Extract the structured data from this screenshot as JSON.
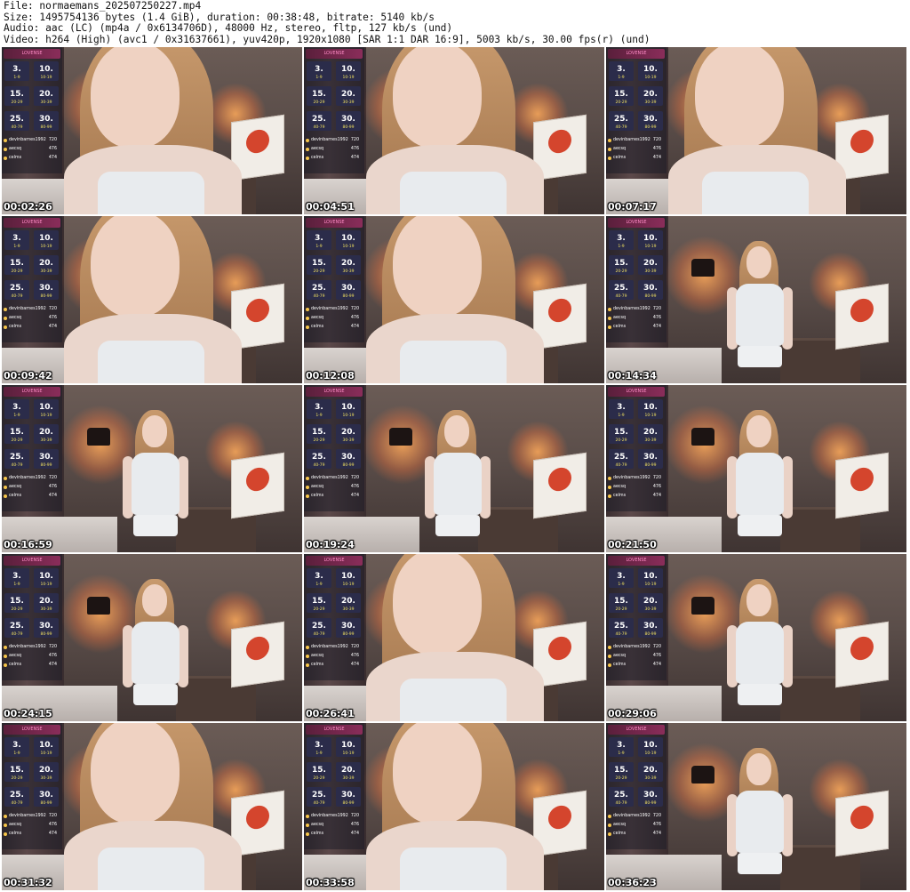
{
  "meta": {
    "file_line": "File: normaemans_202507250227.mp4",
    "size_line": "Size: 1495754136 bytes (1.4 GiB), duration: 00:38:48, bitrate: 5140 kb/s",
    "audio_line": "Audio: aac (LC) (mp4a / 0x6134706D), 48000 Hz, stereo, fltp, 127 kb/s (und)",
    "video_line": "Video: h264 (High) (avc1 / 0x31637661), yuv420p, 1920x1080 [SAR 1:1 DAR 16:9], 5003 kb/s, 30.00 fps(r) (und)"
  },
  "overlay": {
    "header": "LOVENSE",
    "tiles": [
      {
        "value": "3.",
        "range": "1-9"
      },
      {
        "value": "10.",
        "range": "10-19"
      },
      {
        "value": "15.",
        "range": "20-29"
      },
      {
        "value": "20.",
        "range": "30-39"
      },
      {
        "value": "25.",
        "range": "40-79"
      },
      {
        "value": "30.",
        "range": "80-99"
      }
    ],
    "tippers": [
      {
        "name": "devinbarnes1992",
        "amount": "720"
      },
      {
        "name": "aecsq",
        "amount": "476"
      },
      {
        "name": "celms",
        "amount": "474"
      }
    ]
  },
  "thumbnails": [
    {
      "timestamp": "00:02:26",
      "shot": "close"
    },
    {
      "timestamp": "00:04:51",
      "shot": "close"
    },
    {
      "timestamp": "00:07:17",
      "shot": "close"
    },
    {
      "timestamp": "00:09:42",
      "shot": "close"
    },
    {
      "timestamp": "00:12:08",
      "shot": "close"
    },
    {
      "timestamp": "00:14:34",
      "shot": "wide"
    },
    {
      "timestamp": "00:16:59",
      "shot": "wide"
    },
    {
      "timestamp": "00:19:24",
      "shot": "wide"
    },
    {
      "timestamp": "00:21:50",
      "shot": "wide"
    },
    {
      "timestamp": "00:24:15",
      "shot": "wide"
    },
    {
      "timestamp": "00:26:41",
      "shot": "close"
    },
    {
      "timestamp": "00:29:06",
      "shot": "wide"
    },
    {
      "timestamp": "00:31:32",
      "shot": "close"
    },
    {
      "timestamp": "00:33:58",
      "shot": "close"
    },
    {
      "timestamp": "00:36:23",
      "shot": "wide"
    }
  ]
}
